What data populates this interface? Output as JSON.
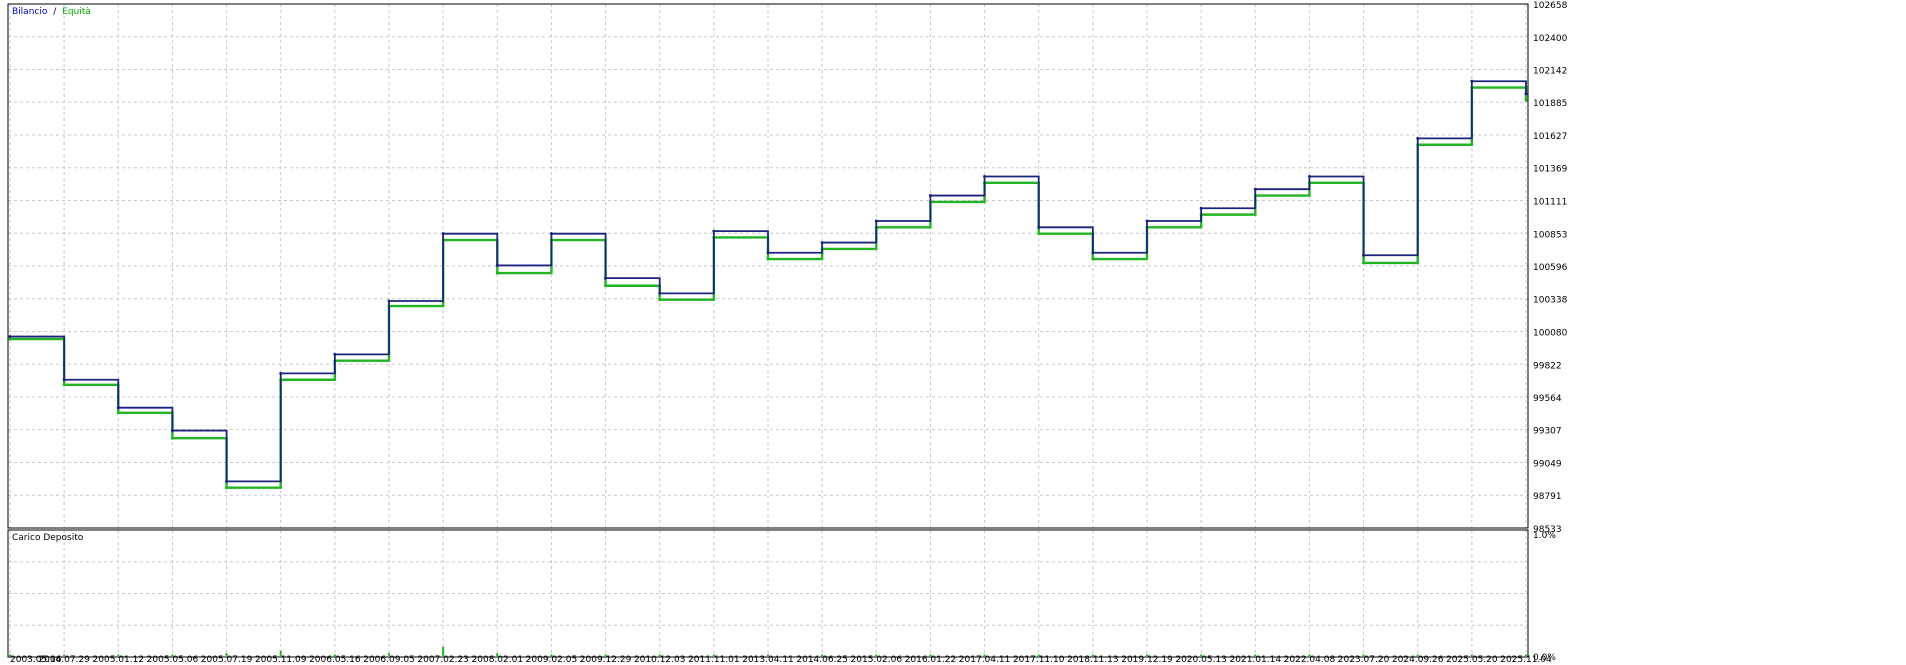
{
  "colors": {
    "background": "#ffffff",
    "grid": "#c8c8c8",
    "frame": "#000000",
    "balance": "#1a237e",
    "equity": "#22b422",
    "legend_balance": "#0000c8",
    "legend_equity": "#00b400",
    "deposit_load": "#22b422"
  },
  "legend": {
    "balance_label": "Bilancio",
    "separator": "/",
    "equity_label": "Equità"
  },
  "sub_panel": {
    "title": "Carico Deposito",
    "y_top_label": "1.0%",
    "y_bottom_label": "0.0%"
  },
  "chart_data": [
    {
      "type": "line",
      "title": "",
      "legend_placement": "top-left",
      "grid": true,
      "ylim": [
        98533,
        102658
      ],
      "y_ticks": [
        "102658",
        "102400",
        "102142",
        "101885",
        "101627",
        "101369",
        "101111",
        "100853",
        "100596",
        "100338",
        "100080",
        "99822",
        "99564",
        "99307",
        "99049",
        "98791",
        "98533"
      ],
      "x_ticks": [
        "2003.05.16",
        "2004.07.29",
        "2005.01.12",
        "2005.05.06",
        "2005.07.19",
        "2005.11.09",
        "2006.05.16",
        "2006.09.05",
        "2007.02.23",
        "2008.02.01",
        "2009.02.05",
        "2009.12.29",
        "2010.12.03",
        "2011.11.01",
        "2013.04.11",
        "2014.06.25",
        "2015.02.06",
        "2016.01.22",
        "2017.04.11",
        "2017.11.10",
        "2018.11.13",
        "2019.12.19",
        "2020.05.13",
        "2021.01.14",
        "2022.04.08",
        "2023.07.20",
        "2024.09.26",
        "2025.05.20",
        "2025.11.04"
      ],
      "series": [
        {
          "name": "Bilancio",
          "x": [
            "2003.05.16",
            "2004.07.29",
            "2005.01.12",
            "2005.05.06",
            "2005.07.19",
            "2005.11.09",
            "2006.05.16",
            "2006.09.05",
            "2007.02.23",
            "2008.02.01",
            "2009.02.05",
            "2009.12.29",
            "2010.12.03",
            "2011.11.01",
            "2013.04.11",
            "2014.06.25",
            "2015.02.06",
            "2016.01.22",
            "2017.04.11",
            "2017.11.10",
            "2018.11.13",
            "2019.12.19",
            "2020.05.13",
            "2021.01.14",
            "2022.04.08",
            "2023.07.20",
            "2024.09.26",
            "2025.05.20",
            "2025.11.04"
          ],
          "values": [
            100040,
            99700,
            99480,
            99300,
            98900,
            99750,
            99900,
            100320,
            100850,
            100600,
            100850,
            100500,
            100380,
            100870,
            100700,
            100780,
            100950,
            101150,
            101300,
            100900,
            100700,
            100950,
            101050,
            101200,
            101300,
            100680,
            101600,
            102050,
            101950
          ]
        },
        {
          "name": "Equità",
          "x": [
            "2003.05.16",
            "2004.07.29",
            "2005.01.12",
            "2005.05.06",
            "2005.07.19",
            "2005.11.09",
            "2006.05.16",
            "2006.09.05",
            "2007.02.23",
            "2008.02.01",
            "2009.02.05",
            "2009.12.29",
            "2010.12.03",
            "2011.11.01",
            "2013.04.11",
            "2014.06.25",
            "2015.02.06",
            "2016.01.22",
            "2017.04.11",
            "2017.11.10",
            "2018.11.13",
            "2019.12.19",
            "2020.05.13",
            "2021.01.14",
            "2022.04.08",
            "2023.07.20",
            "2024.09.26",
            "2025.05.20",
            "2025.11.04"
          ],
          "values": [
            100020,
            99660,
            99440,
            99240,
            98850,
            99700,
            99850,
            100280,
            100800,
            100540,
            100800,
            100440,
            100330,
            100820,
            100650,
            100730,
            100900,
            101100,
            101250,
            100850,
            100650,
            100900,
            101000,
            101150,
            101250,
            100620,
            101550,
            102000,
            101900
          ]
        }
      ]
    },
    {
      "type": "bar",
      "title": "Carico Deposito",
      "ylim": [
        0,
        1
      ],
      "y_ticks": [
        "1.0%",
        "0.0%"
      ],
      "x": [
        "2003.05.16",
        "2004.07.29",
        "2005.01.12",
        "2005.05.06",
        "2005.07.19",
        "2005.11.09",
        "2006.05.16",
        "2006.09.05",
        "2007.02.23",
        "2008.02.01",
        "2009.02.05",
        "2009.12.29",
        "2010.12.03",
        "2011.11.01",
        "2013.04.11",
        "2014.06.25",
        "2015.02.06",
        "2016.01.22",
        "2017.04.11",
        "2017.11.10",
        "2018.11.13",
        "2019.12.19",
        "2020.05.13",
        "2021.01.14",
        "2022.04.08",
        "2023.07.20",
        "2024.09.26",
        "2025.05.20",
        "2025.11.04"
      ],
      "values": [
        0.02,
        0.02,
        0.02,
        0.02,
        0.03,
        0.05,
        0.02,
        0.03,
        0.08,
        0.03,
        0.02,
        0.02,
        0.02,
        0.02,
        0.02,
        0.02,
        0.02,
        0.02,
        0.02,
        0.02,
        0.02,
        0.02,
        0.02,
        0.02,
        0.02,
        0.02,
        0.02,
        0.02,
        0.02
      ]
    }
  ]
}
